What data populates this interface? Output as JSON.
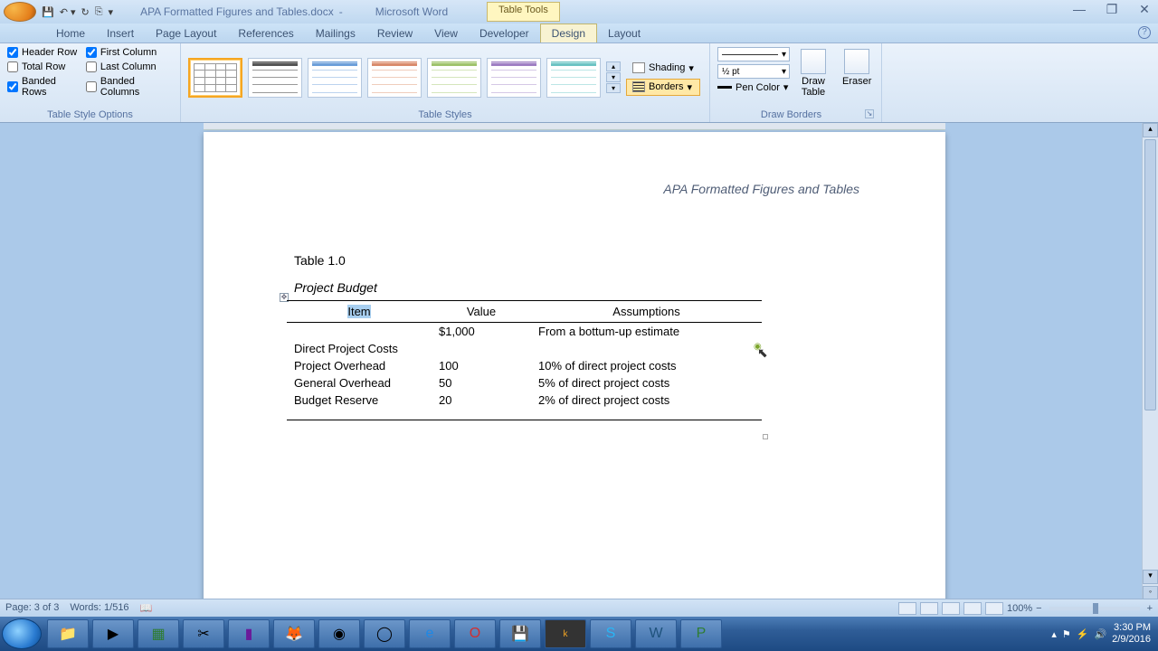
{
  "titlebar": {
    "doc_name": "APA Formatted Figures and Tables.docx",
    "app_name": "Microsoft Word",
    "context_tab": "Table Tools"
  },
  "tabs": {
    "items": [
      "Home",
      "Insert",
      "Page Layout",
      "References",
      "Mailings",
      "Review",
      "View",
      "Developer",
      "Design",
      "Layout"
    ],
    "active": "Design"
  },
  "ribbon": {
    "style_options": {
      "label": "Table Style Options",
      "header_row": "Header Row",
      "total_row": "Total Row",
      "banded_rows": "Banded Rows",
      "first_column": "First Column",
      "last_column": "Last Column",
      "banded_columns": "Banded Columns"
    },
    "table_styles": {
      "label": "Table Styles"
    },
    "shading": "Shading",
    "borders": "Borders",
    "draw_borders": {
      "label": "Draw Borders",
      "weight": "½ pt",
      "pen_color": "Pen Color",
      "draw_table": "Draw\nTable",
      "eraser": "Eraser"
    }
  },
  "doc": {
    "running_head": "APA Formatted Figures and Tables",
    "table_num": "Table 1.0",
    "table_title": "Project Budget",
    "headers": {
      "item": "Item",
      "value": "Value",
      "assumptions": "Assumptions"
    },
    "rows": [
      {
        "item": "",
        "value": "$1,000",
        "assumptions": "From a bottum-up estimate"
      },
      {
        "item": "Direct Project Costs",
        "value": "",
        "assumptions": ""
      },
      {
        "item": "Project Overhead",
        "value": "100",
        "assumptions": "10% of direct project costs"
      },
      {
        "item": "General Overhead",
        "value": "50",
        "assumptions": "5% of direct project costs"
      },
      {
        "item": "Budget Reserve",
        "value": "20",
        "assumptions": "2% of direct project costs"
      }
    ]
  },
  "statusbar": {
    "page": "Page: 3 of 3",
    "words": "Words: 1/516",
    "zoom": "100%"
  },
  "tray": {
    "time": "3:30 PM",
    "date": "2/9/2016"
  }
}
